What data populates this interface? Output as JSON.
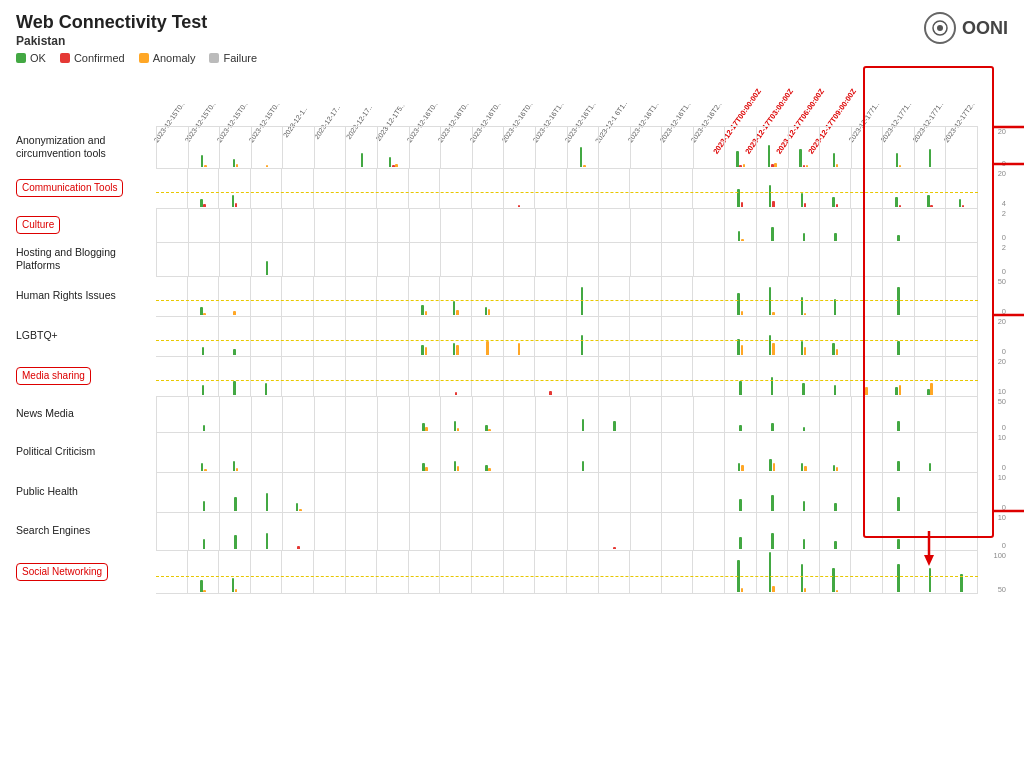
{
  "page": {
    "title": "Web Connectivity Test",
    "subtitle": "Pakistan"
  },
  "legend": {
    "ok_label": "OK",
    "confirmed_label": "Confirmed",
    "anomaly_label": "Anomaly",
    "failure_label": "Failure",
    "ok_color": "#43a843",
    "confirmed_color": "#e53935",
    "anomaly_color": "#ffa726",
    "failure_color": "#bbbbbb"
  },
  "ooni": {
    "label": "OONI"
  },
  "col_headers": [
    "2023-12-15T0..",
    "2023-12-15T0..",
    "2023-12-15T0..",
    "2023-12-15T0..",
    "2023-12-1..",
    "2023-12-17..",
    "2023-12-17..",
    "2023-12-1T5..",
    "2023-12-16T0..",
    "2023-12-16T0..",
    "2023-12-16T0..",
    "2023-12-16T0..",
    "2023-12-16T1..",
    "2023-12-16T1..",
    "2023-12-1 6T1..",
    "2023-12-16T1..",
    "2023-12-16T1..",
    "2023-12-16T2..",
    "2023-12-17T00:00:00Z",
    "2023-12-17T03:00:00Z",
    "2023-12-17T06:00:00Z",
    "2023-12-17T09:00:00Z",
    "2023-12-1771..",
    "2023-12-1771..",
    "2023-12-1771..",
    "2023-12-17T2.."
  ],
  "highlighted_cols": [
    18,
    19,
    20,
    21
  ],
  "rows": [
    {
      "id": "anon",
      "label": "Anonymization and\ncircumvention tools",
      "highlighted": false,
      "height": 42,
      "axis_max": "20",
      "axis_mid": "0",
      "has_dashed": false
    },
    {
      "id": "comm",
      "label": "Communication Tools",
      "highlighted": true,
      "height": 40,
      "axis_max": "20",
      "axis_mid": "4",
      "has_dashed": true
    },
    {
      "id": "culture",
      "label": "Culture",
      "highlighted": true,
      "height": 34,
      "axis_max": "2",
      "axis_mid": "0",
      "has_dashed": false
    },
    {
      "id": "hosting",
      "label": "Hosting and Blogging\nPlatforms",
      "highlighted": false,
      "height": 34,
      "axis_max": "2",
      "axis_mid": "0",
      "has_dashed": false
    },
    {
      "id": "human",
      "label": "Human Rights Issues",
      "highlighted": false,
      "height": 40,
      "axis_max": "50",
      "axis_mid": "0",
      "has_dashed": true
    },
    {
      "id": "lgbtq",
      "label": "LGBTQ+",
      "highlighted": false,
      "height": 40,
      "axis_max": "20",
      "axis_mid": "0",
      "has_dashed": true
    },
    {
      "id": "media",
      "label": "Media sharing",
      "highlighted": true,
      "height": 40,
      "axis_max": "20",
      "axis_mid": "10",
      "has_dashed": true
    },
    {
      "id": "news",
      "label": "News Media",
      "highlighted": false,
      "height": 36,
      "axis_max": "50",
      "axis_mid": "0",
      "has_dashed": false
    },
    {
      "id": "political",
      "label": "Political Criticism",
      "highlighted": false,
      "height": 40,
      "axis_max": "10",
      "axis_mid": "0",
      "has_dashed": false
    },
    {
      "id": "public",
      "label": "Public Health",
      "highlighted": false,
      "height": 40,
      "axis_max": "10",
      "axis_mid": "0",
      "has_dashed": false
    },
    {
      "id": "search",
      "label": "Search Engines",
      "highlighted": false,
      "height": 38,
      "axis_max": "10",
      "axis_mid": "0",
      "has_dashed": false
    },
    {
      "id": "social",
      "label": "Social Networking",
      "highlighted": true,
      "height": 44,
      "axis_max": "100",
      "axis_mid": "50",
      "has_dashed": true
    }
  ]
}
